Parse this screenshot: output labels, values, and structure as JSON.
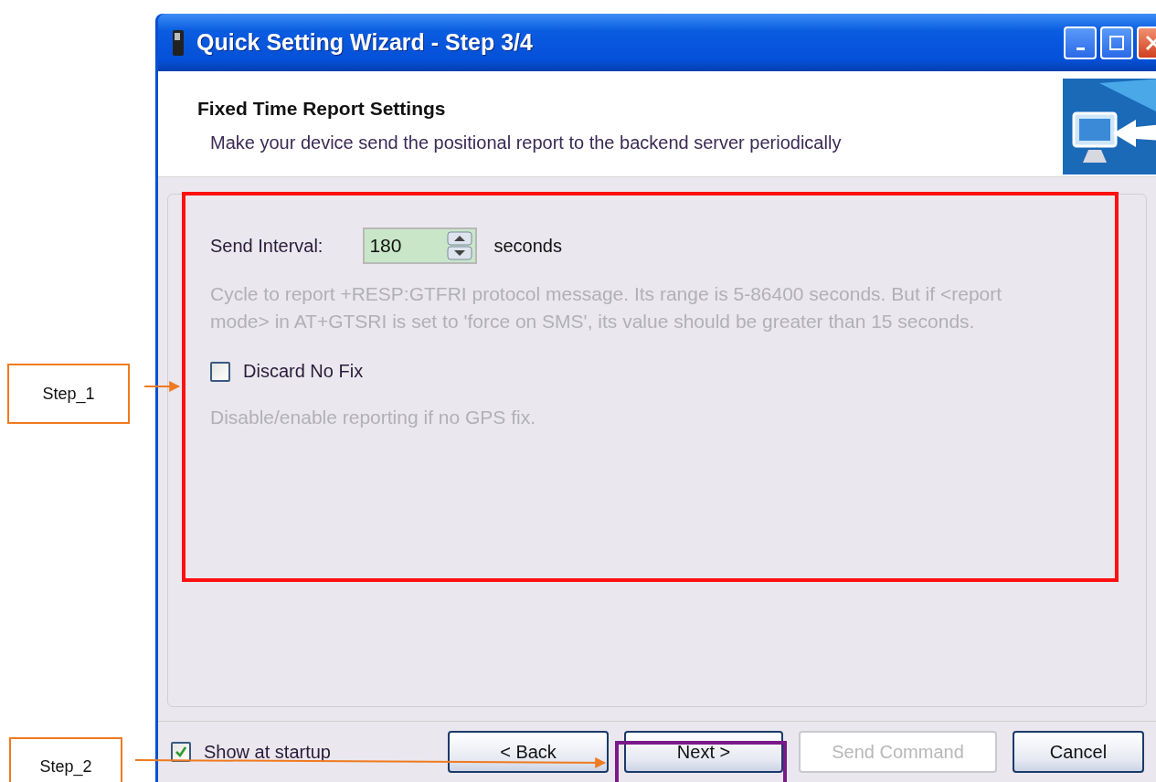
{
  "window": {
    "title": "Quick Setting Wizard - Step 3/4"
  },
  "header": {
    "title": "Fixed Time Report Settings",
    "subtitle": "Make your device send the positional report to the backend server periodically"
  },
  "settings": [
    {
      "kind": "spinner",
      "label": "Send Interval:",
      "value": "180",
      "unit": "seconds",
      "help": "Cycle to report +RESP:GTFRI protocol message. Its range is 5-86400 seconds. But if <report mode> in AT+GTSRI is set to 'force on SMS', its value should be greater than 15 seconds."
    },
    {
      "kind": "checkbox",
      "label": "Discard No Fix",
      "checked": false,
      "help": "Disable/enable reporting if no GPS fix."
    }
  ],
  "footer": {
    "startup": {
      "label": "Show at startup",
      "checked": true
    },
    "buttons": [
      {
        "label": "< Back",
        "disabled": false
      },
      {
        "label": "Next >",
        "disabled": false
      },
      {
        "label": "Send Command",
        "disabled": true
      },
      {
        "label": "Cancel",
        "disabled": false
      }
    ]
  },
  "annotations": [
    {
      "label": "Step_1"
    },
    {
      "label": "Step_2"
    }
  ]
}
